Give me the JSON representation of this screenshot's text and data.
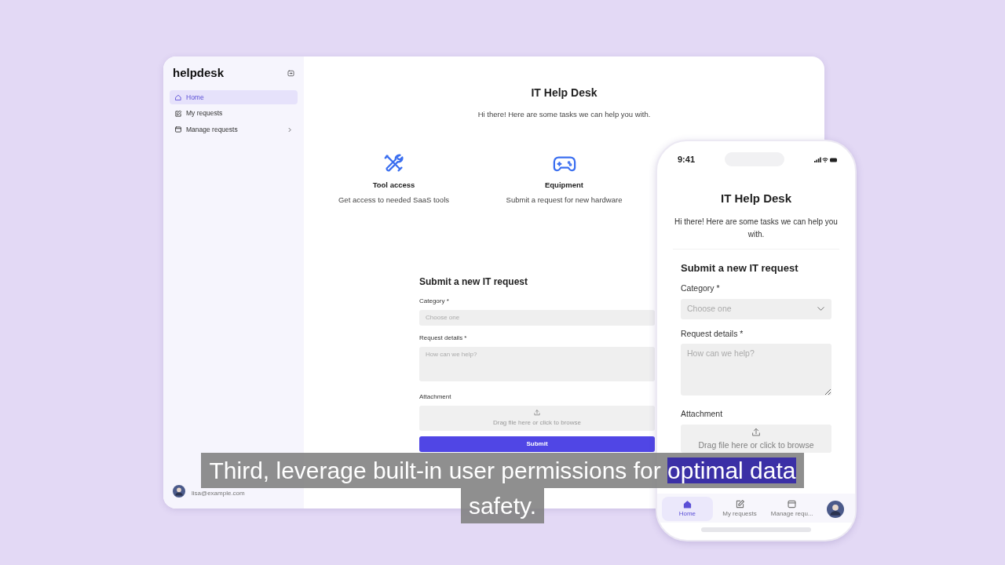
{
  "desktop": {
    "sidebar": {
      "logo": "helpdesk",
      "items": [
        {
          "label": "Home",
          "selected": true,
          "has_submenu": false
        },
        {
          "label": "My requests",
          "selected": false,
          "has_submenu": false
        },
        {
          "label": "Manage requests",
          "selected": false,
          "has_submenu": true
        }
      ],
      "user": {
        "email": "lisa@example.com"
      }
    },
    "main": {
      "title": "IT Help Desk",
      "subtitle": "Hi there! Here are some tasks we can help you with.",
      "tasks": [
        {
          "title": "Tool access",
          "description": "Get access to needed SaaS tools"
        },
        {
          "title": "Equipment",
          "description": "Submit a request for new hardware"
        }
      ],
      "form": {
        "title": "Submit a new IT request",
        "fields": [
          {
            "kind": "select",
            "label": "Category *",
            "placeholder": "Choose one"
          },
          {
            "kind": "textarea",
            "label": "Request details *",
            "placeholder": "How can we help?"
          },
          {
            "kind": "file",
            "label": "Attachment",
            "hint": "Drag file here or click to browse"
          }
        ],
        "submit": "Submit"
      }
    }
  },
  "phone": {
    "time": "9:41",
    "title": "IT Help Desk",
    "subtitle": "Hi there! Here are some tasks we can help you with.",
    "form": {
      "title": "Submit a new IT request",
      "fields": [
        {
          "kind": "select",
          "label": "Category *",
          "placeholder": "Choose one"
        },
        {
          "kind": "textarea",
          "label": "Request details *",
          "placeholder": "How can we help?"
        },
        {
          "kind": "file",
          "label": "Attachment",
          "hint": "Drag file here or click to browse"
        }
      ]
    },
    "tab_bar": [
      {
        "label": "Home",
        "selected": true
      },
      {
        "label": "My requests",
        "selected": false
      },
      {
        "label": "Manage requ...",
        "selected": false
      }
    ]
  },
  "caption": {
    "lines": [
      [
        {
          "text": "Third, leverage built-in user permissions for ",
          "highlighted": false
        },
        {
          "text": "optimal data",
          "highlighted": true
        }
      ],
      [
        {
          "text": "safety.",
          "highlighted": false
        }
      ]
    ]
  }
}
